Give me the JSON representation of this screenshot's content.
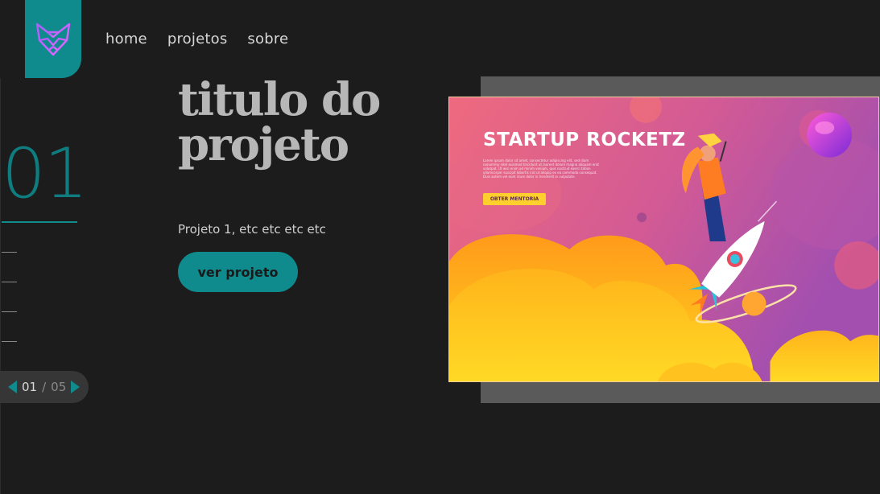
{
  "nav": {
    "items": [
      {
        "label": "home"
      },
      {
        "label": "projetos"
      },
      {
        "label": "sobre"
      }
    ]
  },
  "slider": {
    "current_big": "01",
    "current": "01",
    "separator": "/",
    "total": "05"
  },
  "project": {
    "title": "titulo do projeto",
    "description": "Projeto 1, etc etc etc etc",
    "cta_label": "ver projeto"
  },
  "hero": {
    "title": "STARTUP ROCKETZ",
    "lorem": "Lorem ipsum dolor sit amet, consectetur adipiscing elit, sed diam nonummy nibh euismod tincidunt ut laoreet dolore magna aliquam erat volutpat. Ut wisi enim ad minim veniam, quis nostrud exerci tation ullamcorper suscipit lobortis nisl ut aliquip ex ea commodo consequat. Duis autem vel eum iriure dolor in hendrerit in vulputate.",
    "button_label": "OBTER MENTORIA"
  },
  "icons": {
    "logo": "fox-icon",
    "prev": "triangle-left-icon",
    "next": "triangle-right-icon"
  },
  "colors": {
    "accent": "#0f8b8d",
    "background": "#1c1c1c",
    "frame": "#5a5a5a",
    "logo_purple": "#c46bff"
  }
}
